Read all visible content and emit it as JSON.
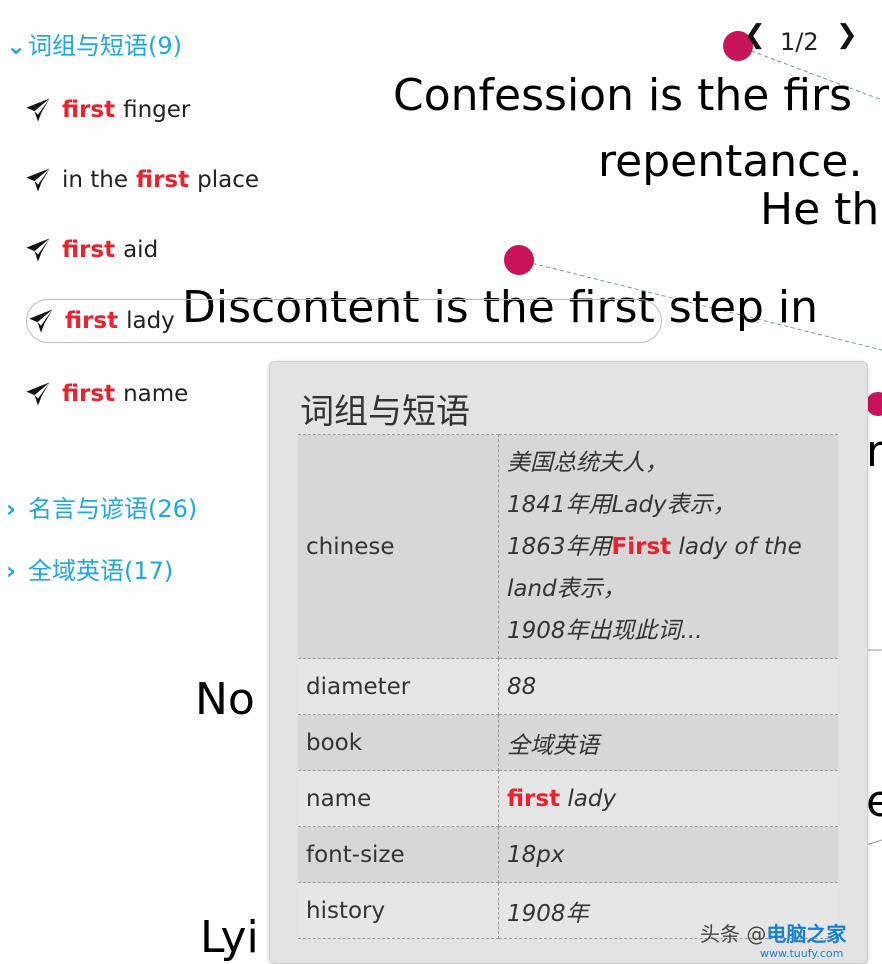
{
  "pager": {
    "prev_icon": "chevron-left-icon",
    "next_icon": "chevron-right-icon",
    "counter": "1/2"
  },
  "sidebar": {
    "groups": [
      {
        "label": "词组与短语(9)",
        "expanded": true
      },
      {
        "label": "名言与谚语(26)",
        "expanded": false
      },
      {
        "label": "全域英语(17)",
        "expanded": false
      }
    ],
    "phrases": [
      {
        "pre": "",
        "keyword": "first",
        "rest": "finger"
      },
      {
        "pre": "in the",
        "keyword": "first",
        "rest": "place"
      },
      {
        "pre": "",
        "keyword": "first",
        "rest": "aid"
      },
      {
        "pre": "",
        "keyword": "first",
        "rest": "lady",
        "selected": true
      },
      {
        "pre": "",
        "keyword": "first",
        "rest": "name"
      }
    ]
  },
  "graph": {
    "sentences": [
      "Confession is the firs",
      "repentance.",
      "He th",
      "Discontent is the first step in",
      "No",
      "Lyi"
    ],
    "node_color": "#c8145a"
  },
  "tooltip": {
    "title": "词组与短语",
    "rows": [
      {
        "key": "chinese",
        "lines": [
          "美国总统夫人，",
          "1841年用Lady表示，"
        ],
        "line3_pre": "1863年用",
        "line3_kw": "First",
        "line3_post": " lady of the",
        "lines_after": [
          "land表示，",
          "1908年出现此词..."
        ]
      },
      {
        "key": "diameter",
        "value": "88"
      },
      {
        "key": "book",
        "value": "全域英语"
      },
      {
        "key": "name",
        "value_kw": "first",
        "value_post": " lady"
      },
      {
        "key": "font-size",
        "value": "18px"
      },
      {
        "key": "history",
        "value": "1908年"
      }
    ]
  },
  "watermark": {
    "prefix": "头条 @",
    "brand": "电脑之家",
    "site": "www.tuufy.com"
  },
  "colors": {
    "accent": "#1ea7e1",
    "keyword": "#e8222e"
  }
}
